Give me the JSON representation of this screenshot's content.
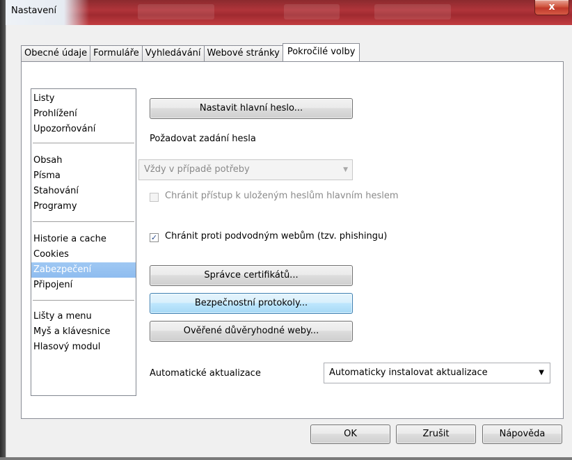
{
  "window": {
    "title": "Nastavení",
    "close_glyph": "x"
  },
  "tabs": [
    {
      "label": "Obecné údaje"
    },
    {
      "label": "Formuláře"
    },
    {
      "label": "Vyhledávání"
    },
    {
      "label": "Webové stránky"
    },
    {
      "label": "Pokročilé volby"
    }
  ],
  "active_tab": "Pokročilé volby",
  "nav": {
    "groups": [
      [
        "Listy",
        "Prohlížení",
        "Upozorňování"
      ],
      [
        "Obsah",
        "Písma",
        "Stahování",
        "Programy"
      ],
      [
        "Historie a cache",
        "Cookies",
        "Zabezpečení",
        "Připojení"
      ],
      [
        "Lišty a menu",
        "Myš a klávesnice",
        "Hlasový modul"
      ]
    ],
    "selected": "Zabezpečení"
  },
  "security": {
    "master_password_button": "Nastavit hlavní heslo...",
    "require_password_label": "Požadovat zadání hesla",
    "require_password_value": "Vždy v případě potřeby",
    "protect_saved_label": "Chránit přístup k uloženým heslům hlavním heslem",
    "protect_saved_checked": false,
    "phishing_label": "Chránit proti podvodným webům (tzv. phishingu)",
    "phishing_checked": true,
    "checkmark": "✓",
    "certificates_button": "Správce certifikátů...",
    "protocols_button": "Bezpečnostní protokoly...",
    "trusted_sites_button": "Ověřené důvěryhodné weby...",
    "auto_updates_label": "Automatické aktualizace",
    "auto_updates_value": "Automaticky instalovat aktualizace"
  },
  "footer": {
    "ok": "OK",
    "cancel": "Zrušit",
    "help": "Nápověda"
  },
  "colors": {
    "titlebar": "#b0343a",
    "selection": "#8ebcef",
    "focused_button": "#bee6fd"
  }
}
